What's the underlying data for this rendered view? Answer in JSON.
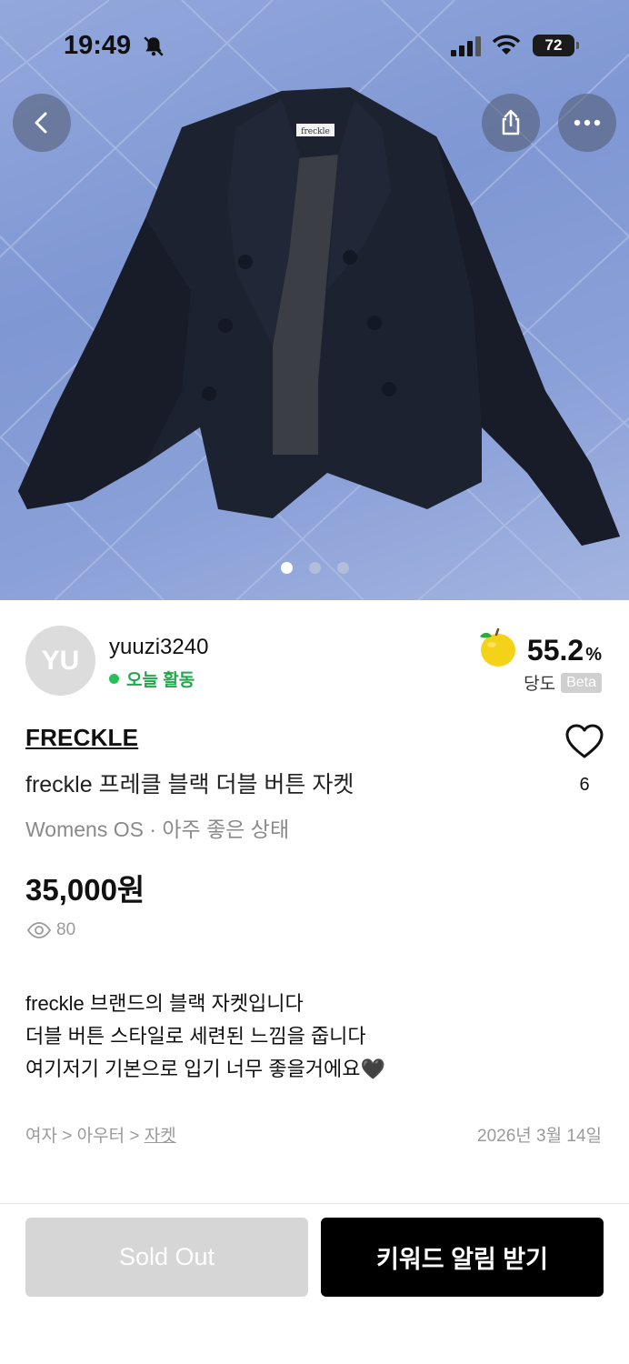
{
  "status_bar": {
    "time": "19:49",
    "battery": "72"
  },
  "hero": {
    "image_label": "freckle",
    "page_count": 3,
    "active_page": 1
  },
  "seller": {
    "avatar_initials": "YU",
    "username": "yuuzi3240",
    "activity": "오늘 활동",
    "rating_value": "55.2",
    "rating_unit": "%",
    "rating_label": "당도",
    "rating_badge": "Beta"
  },
  "product": {
    "brand": "FRECKLE",
    "title": "freckle 프레클 블랙 더블 버튼 자켓",
    "meta": "Womens OS · 아주 좋은 상태",
    "price": "35,000원",
    "views": "80",
    "likes": "6",
    "description": [
      "freckle 브랜드의 블랙 자켓입니다",
      "더블 버튼 스타일로 세련된 느낌을 줍니다",
      "여기저기 기본으로 입기 너무 좋을거에요🖤"
    ],
    "category_path": "여자 > 아우터 > ",
    "category_leaf": "자켓",
    "posted_date": "2026년 3월 14일"
  },
  "actions": {
    "sold_out": "Sold Out",
    "keyword_alert": "키워드 알림 받기"
  },
  "colors": {
    "accent_green": "#2bbf5a",
    "primary_button": "#000000",
    "disabled_button": "#d6d6d6"
  },
  "icons": [
    "back-icon",
    "share-icon",
    "more-icon",
    "bell-off-icon",
    "signal-icon",
    "wifi-icon",
    "battery-icon",
    "apple-icon",
    "heart-icon",
    "eye-icon"
  ]
}
